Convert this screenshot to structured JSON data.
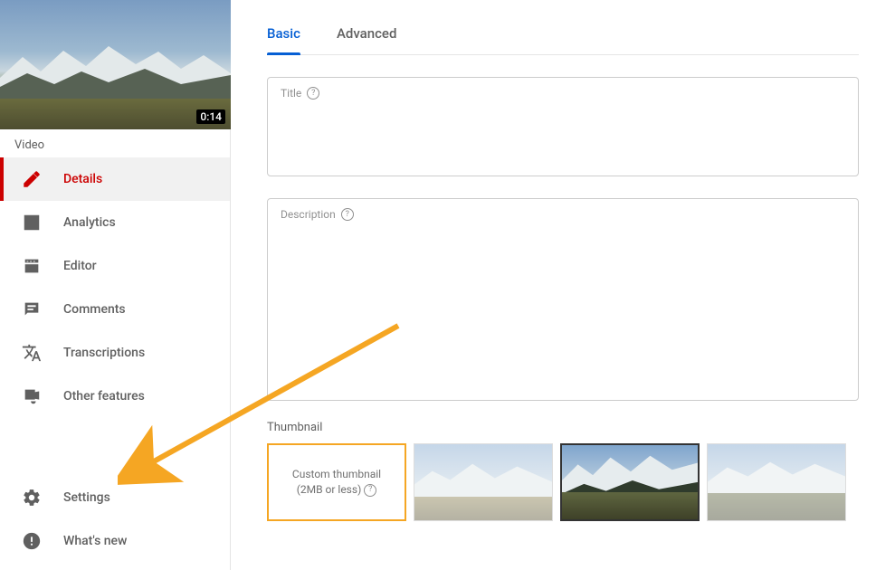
{
  "sidebar": {
    "section_label": "Video",
    "duration": "0:14",
    "items": [
      {
        "label": "Details"
      },
      {
        "label": "Analytics"
      },
      {
        "label": "Editor"
      },
      {
        "label": "Comments"
      },
      {
        "label": "Transcriptions"
      },
      {
        "label": "Other features"
      }
    ],
    "bottom": [
      {
        "label": "Settings"
      },
      {
        "label": "What's new"
      }
    ]
  },
  "tabs": {
    "basic": "Basic",
    "advanced": "Advanced"
  },
  "fields": {
    "title_label": "Title",
    "description_label": "Description"
  },
  "thumbnail": {
    "section_label": "Thumbnail",
    "custom_line1": "Custom thumbnail",
    "custom_line2": "(2MB or less)"
  },
  "annotation": {
    "highlight_color": "#f5a623"
  }
}
